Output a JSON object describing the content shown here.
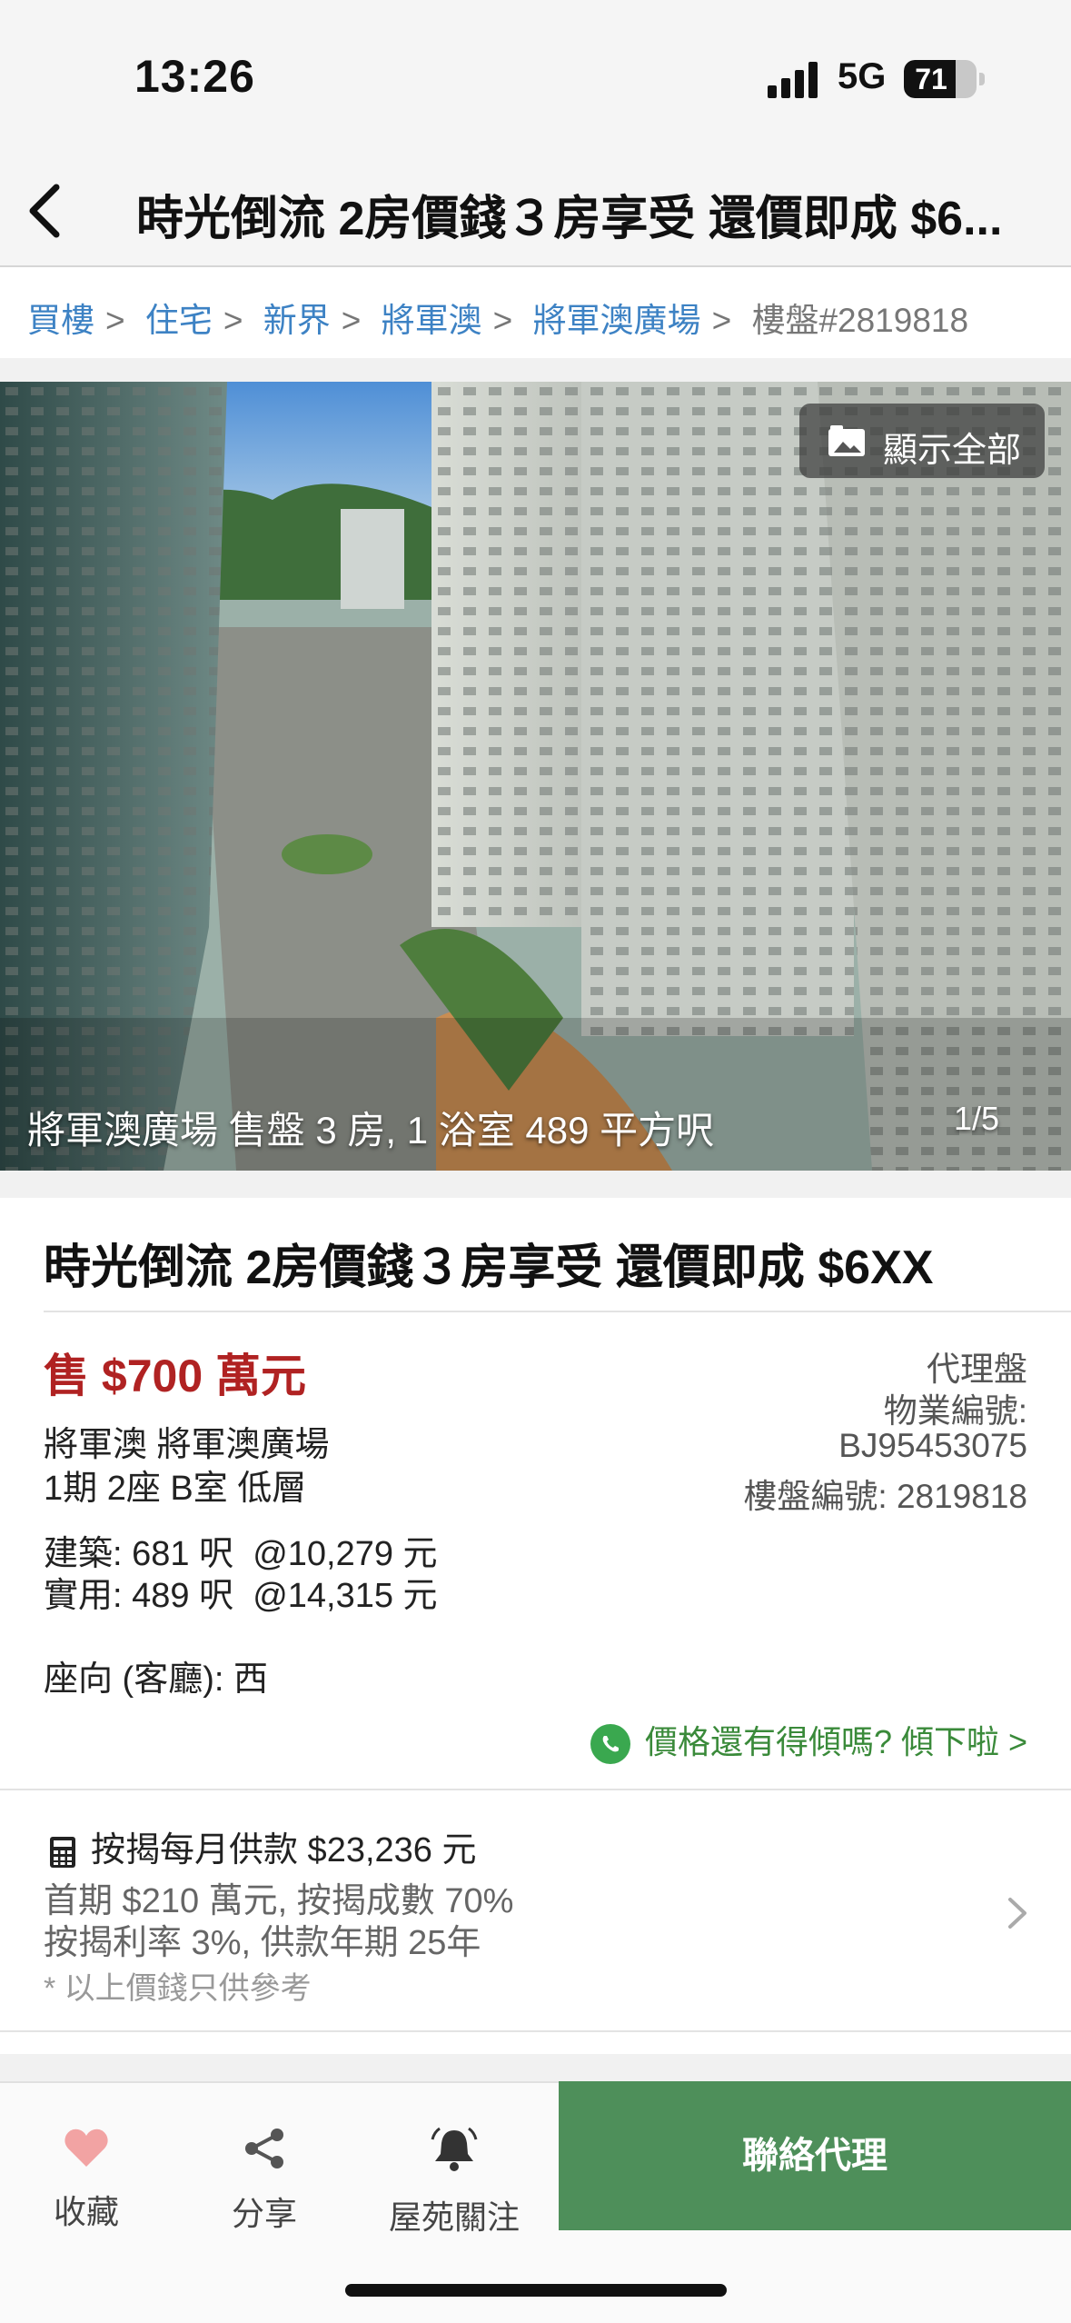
{
  "status_bar": {
    "time": "13:26",
    "network": "5G",
    "battery": "71",
    "battery_level": 0.71
  },
  "nav": {
    "title": "時光倒流 2房價錢３房享受  還價即成 $6..."
  },
  "breadcrumb": {
    "items": [
      "買樓",
      "住宅",
      "新界",
      "將軍澳",
      "將軍澳廣場"
    ],
    "current": "樓盤#2819818"
  },
  "photo": {
    "show_all_label": "顯示全部",
    "caption": "將軍澳廣場 售盤 3 房, 1 浴室 489 平方呎",
    "counter": "1/5"
  },
  "listing": {
    "title": "時光倒流 2房價錢３房享受  還價即成 $6XX",
    "price": "售 $700 萬元",
    "address_line1": "將軍澳 將軍澳廣場",
    "address_line2": "1期 2座 B室 低層",
    "agent_type": "代理盤",
    "property_code_label": "物業編號:",
    "property_code": "BJ95453075",
    "listing_no": "樓盤編號: 2819818",
    "gross_area": "建築: 681 呎  @10,279 元",
    "saleable_area": "實用: 489 呎  @14,315 元",
    "orientation": "座向 (客廳): 西",
    "whatsapp_cta": "價格還有得傾嗎? 傾下啦 >"
  },
  "mortgage": {
    "heading": "按揭每月供款 $23,236 元",
    "line1": "首期 $210 萬元, 按揭成數 70%",
    "line2": "按揭利率 3%, 供款年期 25年",
    "note": "* 以上價錢只供參考"
  },
  "bottom_bar": {
    "favorite_label": "收藏",
    "share_label": "分享",
    "follow_label": "屋苑關注",
    "contact_label": "聯絡代理"
  },
  "colors": {
    "price_red": "#b02222",
    "link_blue": "#3d82c4",
    "accent_green": "#4e8f5a",
    "heart_pink": "#f2a3a3"
  }
}
